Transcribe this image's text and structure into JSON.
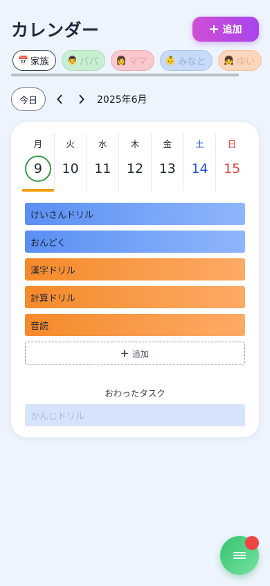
{
  "header": {
    "title": "カレンダー",
    "add_label": "追加"
  },
  "members": [
    {
      "label": "家族",
      "icon": "📅",
      "active": true
    },
    {
      "label": "パパ",
      "icon": "👨",
      "active": false
    },
    {
      "label": "ママ",
      "icon": "👩",
      "active": false
    },
    {
      "label": "みなと",
      "icon": "👶",
      "active": false
    },
    {
      "label": "ゆい",
      "icon": "👧",
      "active": false
    }
  ],
  "nav": {
    "today_label": "今日",
    "month_label": "2025年6月"
  },
  "week": [
    {
      "dow": "月",
      "num": "9",
      "selected": true
    },
    {
      "dow": "火",
      "num": "10"
    },
    {
      "dow": "水",
      "num": "11"
    },
    {
      "dow": "木",
      "num": "12"
    },
    {
      "dow": "金",
      "num": "13"
    },
    {
      "dow": "土",
      "num": "14"
    },
    {
      "dow": "日",
      "num": "15"
    }
  ],
  "tasks": [
    {
      "label": "けいさんドリル",
      "color": "blue"
    },
    {
      "label": "おんどく",
      "color": "blue"
    },
    {
      "label": "漢字ドリル",
      "color": "orange"
    },
    {
      "label": "計算ドリル",
      "color": "orange"
    },
    {
      "label": "音読",
      "color": "orange"
    }
  ],
  "add_task_label": "追加",
  "done": {
    "title": "おわったタスク",
    "items": [
      {
        "label": "かんじドリル"
      }
    ]
  },
  "colors": {
    "accent_purple": "#b04ae6",
    "selected_ring": "#3a9a4b",
    "today_underline": "#f59e0b",
    "saturday": "#2554d6",
    "sunday": "#e0413d",
    "fab": "#34c470",
    "badge": "#ef4444"
  },
  "icons": {
    "add": "plus-icon",
    "prev": "chevron-left-icon",
    "next": "chevron-right-icon",
    "menu": "menu-icon"
  }
}
